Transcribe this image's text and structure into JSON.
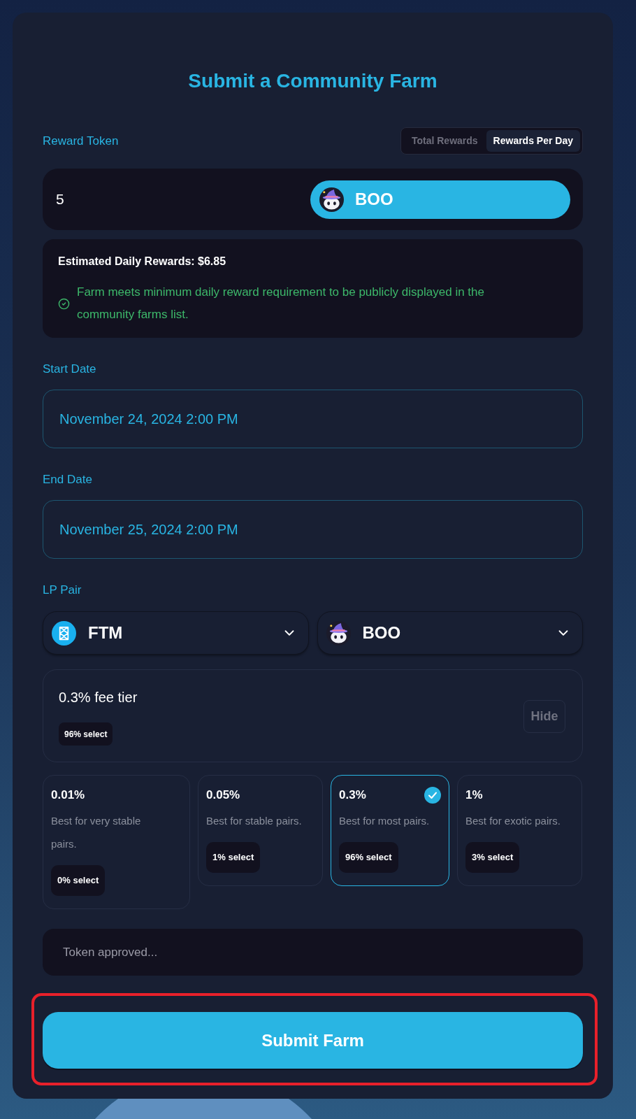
{
  "title": "Submit a Community Farm",
  "reward_token": {
    "label": "Reward Token",
    "modes": [
      {
        "label": "Total Rewards",
        "selected": false
      },
      {
        "label": "Rewards Per Day",
        "selected": true
      }
    ],
    "amount": "5",
    "token": {
      "symbol": "BOO",
      "kind": "boo"
    }
  },
  "estimate": {
    "text": "Estimated Daily Rewards: $6.85",
    "requirement": {
      "met": true,
      "message": "Farm meets minimum daily reward requirement to be publicly displayed in the community farms list."
    }
  },
  "start_date": {
    "label": "Start Date",
    "value": "November 24, 2024 2:00 PM"
  },
  "end_date": {
    "label": "End Date",
    "value": "November 25, 2024 2:00 PM"
  },
  "lp_pair": {
    "label": "LP Pair",
    "tokens": [
      {
        "symbol": "FTM",
        "kind": "ftm"
      },
      {
        "symbol": "BOO",
        "kind": "boo"
      }
    ]
  },
  "fee_summary": {
    "title": "0.3% fee tier",
    "badge": "96% select",
    "hide_button": "Hide"
  },
  "fee_tiers": [
    {
      "fee": "0.01%",
      "description": "Best for very stable pairs.",
      "badge": "0% select",
      "selected": false
    },
    {
      "fee": "0.05%",
      "description": "Best for stable pairs.",
      "badge": "1% select",
      "selected": false
    },
    {
      "fee": "0.3%",
      "description": "Best for most pairs.",
      "badge": "96% select",
      "selected": true
    },
    {
      "fee": "1%",
      "description": "Best for exotic pairs.",
      "badge": "3% select",
      "selected": false
    }
  ],
  "status_message": "Token approved...",
  "submit": {
    "label": "Submit Farm",
    "highlighted": true
  }
}
